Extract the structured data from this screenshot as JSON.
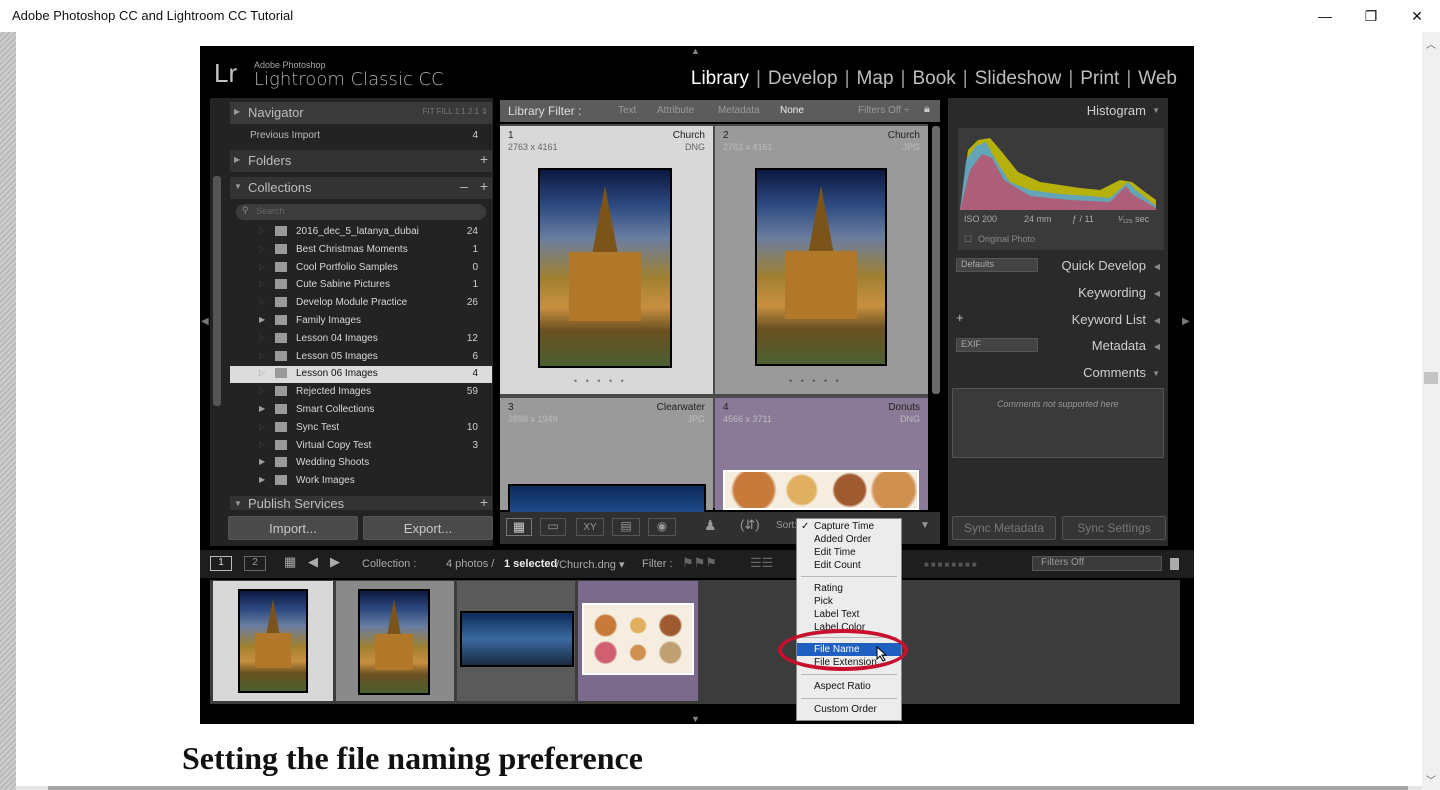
{
  "window": {
    "title": "Adobe Photoshop CC and Lightroom CC Tutorial",
    "minimize_glyph": "—",
    "restore_glyph": "❐",
    "close_glyph": "✕"
  },
  "lightroom": {
    "logo": "Lr",
    "brand_line1": "Adobe Photoshop",
    "brand_line2": "Lightroom Classic CC",
    "modules": [
      "Library",
      "Develop",
      "Map",
      "Book",
      "Slideshow",
      "Print",
      "Web"
    ],
    "active_module": "Library",
    "left_panel": {
      "navigator": "Navigator",
      "nav_zoom": "FIT   FILL   1:1   2:1 ⇕",
      "previous_import": "Previous Import",
      "previous_import_count": "4",
      "folders": "Folders",
      "collections": "Collections",
      "collection_search_placeholder": "Search",
      "collections_list": [
        {
          "name": "2016_dec_5_latanya_dubai",
          "count": "24"
        },
        {
          "name": "Best Christmas Moments",
          "count": "1"
        },
        {
          "name": "Cool Portfolio Samples",
          "count": "0"
        },
        {
          "name": "Cute Sabine Pictures",
          "count": "1"
        },
        {
          "name": "Develop Module Practice",
          "count": "26"
        },
        {
          "name": "Family Images",
          "count": ""
        },
        {
          "name": "Lesson 04 Images",
          "count": "12"
        },
        {
          "name": "Lesson 05 Images",
          "count": "6"
        },
        {
          "name": "Lesson 06 Images",
          "count": "4"
        },
        {
          "name": "Rejected Images",
          "count": "59"
        },
        {
          "name": "Smart Collections",
          "count": ""
        },
        {
          "name": "Sync Test",
          "count": "10"
        },
        {
          "name": "Virtual Copy Test",
          "count": "3"
        },
        {
          "name": "Wedding Shoots",
          "count": ""
        },
        {
          "name": "Work Images",
          "count": ""
        }
      ],
      "selected_collection": "Lesson 06 Images",
      "publish_services": "Publish Services",
      "import_button": "Import...",
      "export_button": "Export..."
    },
    "library_filter": {
      "label": "Library Filter :",
      "options": [
        "Text",
        "Attribute",
        "Metadata",
        "None"
      ],
      "filters_state": "Filters Off ÷"
    },
    "grid": [
      {
        "index": "1",
        "caption": "Church",
        "dims": "2763 x 4161",
        "type": "DNG"
      },
      {
        "index": "2",
        "caption": "Church",
        "dims": "2763 x 4161",
        "type": "JPG"
      },
      {
        "index": "3",
        "caption": "Clearwater",
        "dims": "3898 x 1949",
        "type": "JPG"
      },
      {
        "index": "4",
        "caption": "Donuts",
        "dims": "4566 x 3711",
        "type": "DNG"
      }
    ],
    "toolbar": {
      "sort_label": "Sort:"
    },
    "sort_menu": {
      "checked_item": "Capture Time",
      "group1": [
        "Capture Time",
        "Added Order",
        "Edit Time",
        "Edit Count"
      ],
      "group2": [
        "Rating",
        "Pick",
        "Label Text",
        "Label Color"
      ],
      "group3": [
        "File Name",
        "File Extension"
      ],
      "group4": [
        "Aspect Ratio"
      ],
      "group5": [
        "Custom Order"
      ],
      "highlighted": "File Name"
    },
    "right_panel": {
      "histogram": "Histogram",
      "iso": "ISO 200",
      "focal": "24 mm",
      "aperture": "ƒ / 11",
      "shutter": "¹⁄₁₂₅ sec",
      "original_photo": "Original Photo",
      "defaults_select": "Defaults",
      "quick_develop": "Quick Develop",
      "keywording": "Keywording",
      "keyword_list": "Keyword List",
      "exif_select": "EXIF",
      "metadata": "Metadata",
      "comments": "Comments",
      "comments_note": "Comments not supported here",
      "sync_metadata": "Sync Metadata",
      "sync_settings": "Sync Settings"
    },
    "filmstrip_bar": {
      "page1": "1",
      "page2": "2",
      "collection_label": "Collection :",
      "photo_status_prefix": "4 photos /",
      "photo_status_selected": "1 selected",
      "photo_status_file": "/Church.dng ▾",
      "filter_label": "Filter :",
      "filters_off": "Filters Off"
    }
  },
  "caption_heading": "Setting the file naming preference",
  "colors": {
    "highlight_blue": "#1f5fbf",
    "annotation_red": "#c8102e",
    "lr_background": "#000000",
    "panel_gray": "#2b2b2b"
  }
}
